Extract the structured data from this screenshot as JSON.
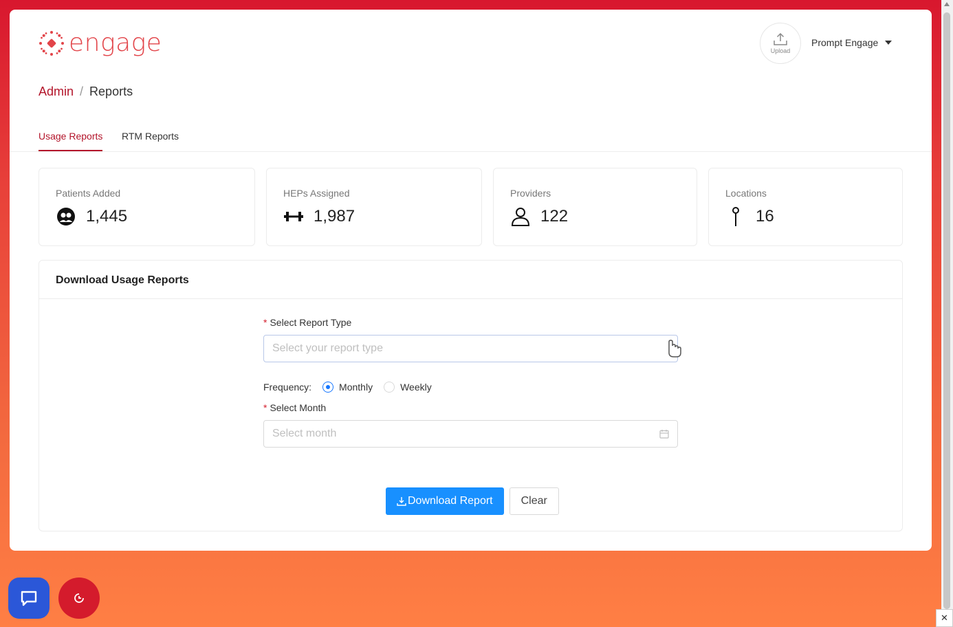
{
  "header": {
    "logo_text": "engage",
    "upload_label": "Upload",
    "user_name": "Prompt Engage"
  },
  "breadcrumb": {
    "parent": "Admin",
    "separator": "/",
    "current": "Reports"
  },
  "tabs": [
    {
      "label": "Usage Reports",
      "active": true
    },
    {
      "label": "RTM Reports",
      "active": false
    }
  ],
  "stats": [
    {
      "title": "Patients Added",
      "value": "1,445",
      "icon": "patients-icon"
    },
    {
      "title": "HEPs Assigned",
      "value": "1,987",
      "icon": "dumbbell-icon"
    },
    {
      "title": "Providers",
      "value": "122",
      "icon": "user-icon"
    },
    {
      "title": "Locations",
      "value": "16",
      "icon": "pin-icon"
    }
  ],
  "download_panel": {
    "title": "Download Usage Reports",
    "report_type_label": "Select Report Type",
    "report_type_placeholder": "Select your report type",
    "frequency_label": "Frequency:",
    "frequency_options": [
      {
        "label": "Monthly",
        "selected": true
      },
      {
        "label": "Weekly",
        "selected": false
      }
    ],
    "month_label": "Select Month",
    "month_placeholder": "Select month",
    "required_mark": "*",
    "download_button": "Download Report",
    "clear_button": "Clear"
  },
  "colors": {
    "brand": "#b3142a",
    "primary": "#1890ff",
    "chat_fab": "#2b57d8",
    "red_fab": "#d41b2c"
  },
  "close_glyph": "✕"
}
